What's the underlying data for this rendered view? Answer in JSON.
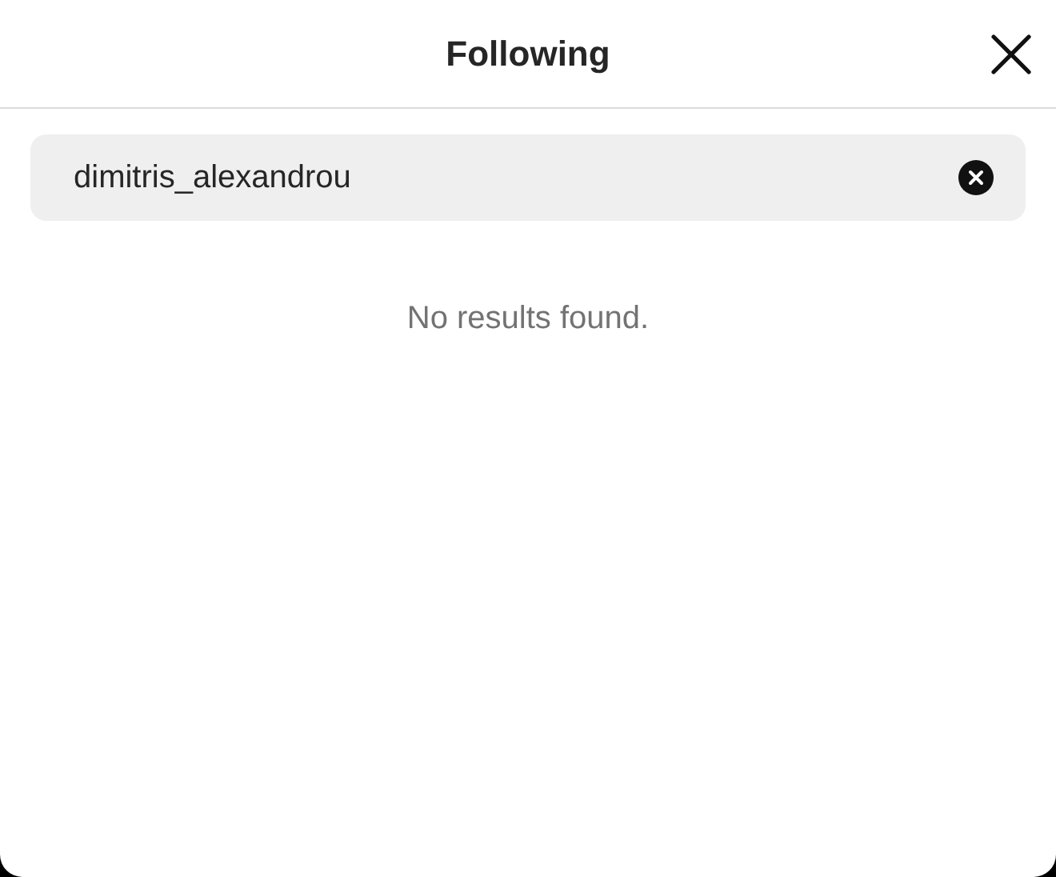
{
  "header": {
    "title": "Following"
  },
  "search": {
    "value": "dimitris_alexandrou"
  },
  "results": {
    "message": "No results found."
  }
}
